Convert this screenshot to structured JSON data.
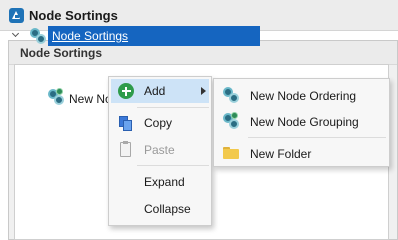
{
  "window": {
    "title": "Node Sortings"
  },
  "panel": {
    "title": "Node Sortings"
  },
  "tree": {
    "root_label": "Node Sortings",
    "child_label": "New No"
  },
  "context_menu": {
    "add_label": "Add",
    "copy_label": "Copy",
    "paste_label": "Paste",
    "expand_label": "Expand",
    "collapse_label": "Collapse"
  },
  "submenu": {
    "new_node_ordering_label": "New Node Ordering",
    "new_node_grouping_label": "New Node Grouping",
    "new_folder_label": "New Folder"
  },
  "state": {
    "hovered_item": "Add",
    "selected_node": "Node Sortings",
    "disabled_items": [
      "Paste"
    ]
  },
  "colors": {
    "selection": "#1565c0",
    "menu_hover": "#cde3f7",
    "add_icon": "#2e9b4b",
    "node_icon": "#2b6d83"
  }
}
